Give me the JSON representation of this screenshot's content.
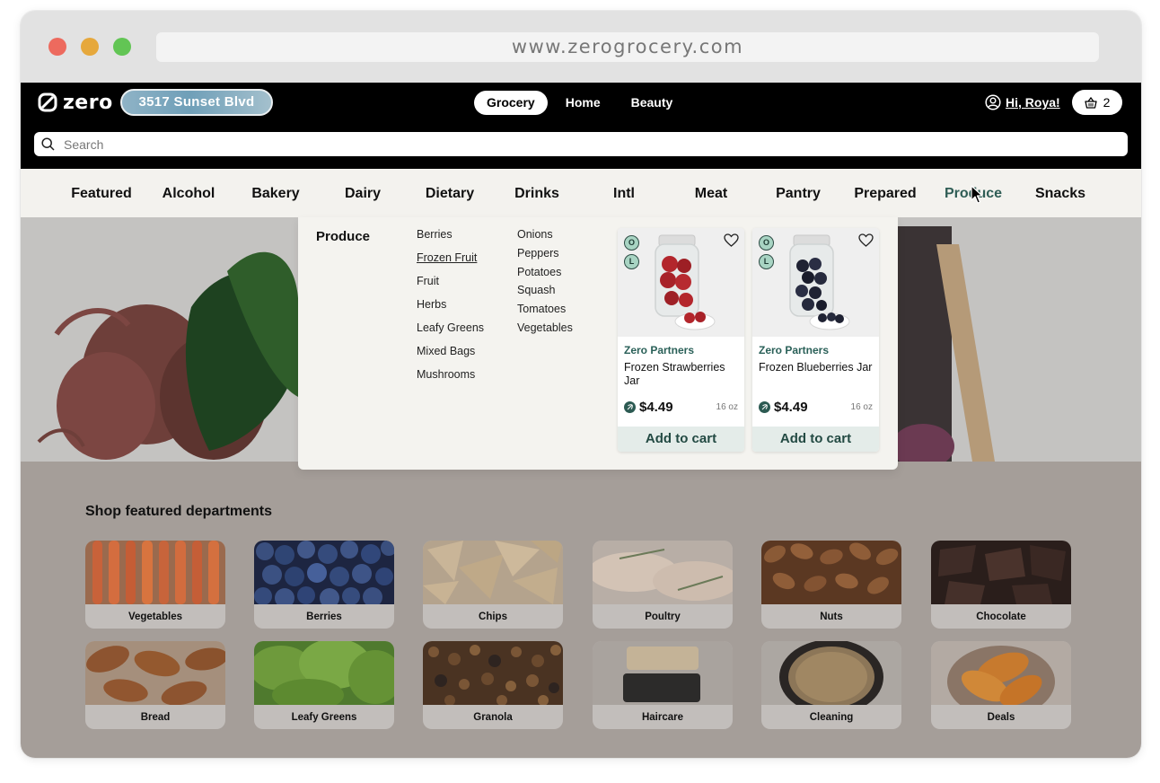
{
  "browser": {
    "url": "www.zerogrocery.com"
  },
  "header": {
    "logo_text": "zero",
    "address": "3517 Sunset Blvd",
    "tabs": [
      {
        "label": "Grocery",
        "active": true
      },
      {
        "label": "Home",
        "active": false
      },
      {
        "label": "Beauty",
        "active": false
      }
    ],
    "greeting": "Hi, Roya!",
    "cart_count": "2",
    "search_placeholder": "Search"
  },
  "categories": [
    {
      "label": "Featured"
    },
    {
      "label": "Alcohol"
    },
    {
      "label": "Bakery"
    },
    {
      "label": "Dairy"
    },
    {
      "label": "Dietary"
    },
    {
      "label": "Drinks"
    },
    {
      "label": "Intl"
    },
    {
      "label": "Meat"
    },
    {
      "label": "Pantry"
    },
    {
      "label": "Prepared"
    },
    {
      "label": "Produce",
      "active": true
    },
    {
      "label": "Snacks"
    }
  ],
  "mega_menu": {
    "title": "Produce",
    "col1": [
      {
        "label": "Berries"
      },
      {
        "label": "Frozen Fruit",
        "active": true
      },
      {
        "label": "Fruit"
      },
      {
        "label": "Herbs"
      },
      {
        "label": "Leafy Greens"
      },
      {
        "label": "Mixed Bags"
      },
      {
        "label": "Mushrooms"
      }
    ],
    "col2": [
      {
        "label": "Onions"
      },
      {
        "label": "Peppers"
      },
      {
        "label": "Potatoes"
      },
      {
        "label": "Squash"
      },
      {
        "label": "Tomatoes"
      },
      {
        "label": "Vegetables"
      }
    ],
    "products": [
      {
        "brand": "Zero Partners",
        "name": "Frozen Strawberries Jar",
        "price": "$4.49",
        "size": "16 oz",
        "badges": [
          "O",
          "L"
        ],
        "button": "Add to cart",
        "fruit_color": "#b3262c"
      },
      {
        "brand": "Zero Partners",
        "name": "Frozen Blueberries Jar",
        "price": "$4.49",
        "size": "16 oz",
        "badges": [
          "O",
          "L"
        ],
        "button": "Add to cart",
        "fruit_color": "#1f2233"
      }
    ]
  },
  "featured": {
    "title": "Shop featured departments",
    "departments": [
      {
        "label": "Vegetables"
      },
      {
        "label": "Berries"
      },
      {
        "label": "Chips"
      },
      {
        "label": "Poultry"
      },
      {
        "label": "Nuts"
      },
      {
        "label": "Chocolate"
      },
      {
        "label": "Bread"
      },
      {
        "label": "Leafy Greens"
      },
      {
        "label": "Granola"
      },
      {
        "label": "Haircare"
      },
      {
        "label": "Cleaning"
      },
      {
        "label": "Deals"
      }
    ]
  },
  "colors": {
    "accent": "#2f5d55",
    "header_bg": "#000000",
    "nav_bg": "#f3f2ee"
  }
}
